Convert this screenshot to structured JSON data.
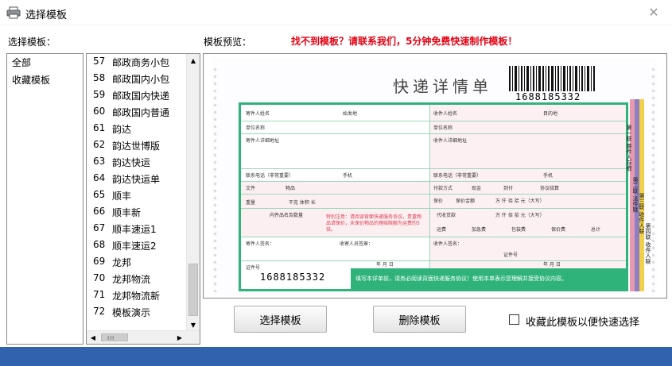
{
  "window": {
    "title": "选择模板",
    "close_glyph": "✕"
  },
  "labels": {
    "category_list": "选择模板：",
    "preview": "模板预览：",
    "promo": "找不到模板？请联系我们，5分钟免费快速制作模板！"
  },
  "categories": [
    "全部",
    "收藏模板"
  ],
  "templates": [
    {
      "num": "57",
      "name": "邮政商务小包"
    },
    {
      "num": "58",
      "name": "邮政国内小包"
    },
    {
      "num": "59",
      "name": "邮政国内快递"
    },
    {
      "num": "60",
      "name": "邮政国内普通"
    },
    {
      "num": "61",
      "name": "韵达"
    },
    {
      "num": "62",
      "name": "韵达世博版"
    },
    {
      "num": "63",
      "name": "韵达快运"
    },
    {
      "num": "64",
      "name": "韵达快运单"
    },
    {
      "num": "65",
      "name": "顺丰"
    },
    {
      "num": "66",
      "name": "顺丰新"
    },
    {
      "num": "67",
      "name": "顺丰速运1"
    },
    {
      "num": "68",
      "name": "顺丰速运2"
    },
    {
      "num": "69",
      "name": "龙邦"
    },
    {
      "num": "70",
      "name": "龙邦物流"
    },
    {
      "num": "71",
      "name": "龙邦物流新"
    },
    {
      "num": "72",
      "name": "模板演示"
    }
  ],
  "scrollbar": {
    "up_glyph": "▲",
    "down_glyph": "▼",
    "left_glyph": "◀",
    "right_glyph": "▶",
    "grip": "III"
  },
  "preview_form": {
    "title": "快递详情单",
    "barcode_number": "1688185332",
    "tracking_number": "1688185332",
    "fields": {
      "sender_name": "寄件人姓名",
      "origin": "始发地",
      "sender_company": "单位名称",
      "sender_address": "寄件人详细地址",
      "sender_phone": "联系电话（非常重要）",
      "sender_mobile": "手机",
      "recipient_name": "收件人姓名",
      "destination": "目的地",
      "recipient_company": "单位名称",
      "recipient_address": "收件人详细地址",
      "recipient_phone": "联系电话（非常重要）",
      "recipient_mobile": "手机",
      "doc": "文件",
      "goods": "物品",
      "weight": "重量",
      "volume": "干克  体积  长",
      "item_name_qty": "内件品名及数量",
      "payment": "付款方式",
      "cash": "现金",
      "cod": "到付",
      "agreement": "协议结算",
      "insured": "保价",
      "insured_amount": "保价金额",
      "collection": "代收货款",
      "freight": "运费",
      "surcharge": "加急费",
      "packing": "包装费",
      "insure_fee": "保价费",
      "total": "总计",
      "sender_sign": "寄件人签名：",
      "receiver_sign": "收寄人员签章：",
      "recipient_sign": "收件人签名：",
      "id_no": "证件号",
      "ymd": "年  月  日",
      "units": "万  仟  佰  拾  元（大写）"
    },
    "warning_text": "特别注意：请阅读背面快递服务协议，贵重物品请保价，未保价物品的理赔限额为运费的5倍。",
    "bottom_notice": "填写本详单前，请务必阅读背面快递服务协议！使用本单表示您理解并接受协议内容。",
    "side_copies": [
      "第一联 寄件人存根",
      "第二联 派件联",
      "第三联 收件人联",
      "第四联 收件人联"
    ]
  },
  "buttons": {
    "select": "选择模板",
    "delete": "删除模板"
  },
  "favorite_checkbox": {
    "label": "收藏此模板以便快速选择",
    "checked": false
  },
  "colors": {
    "promo": "#e60012",
    "form_green": "#2fb37a",
    "band": "#2f63ad"
  }
}
